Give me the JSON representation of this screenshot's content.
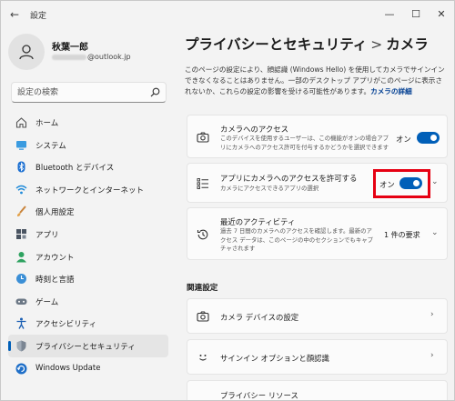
{
  "app": {
    "title": "設定",
    "back_icon": "back-arrow-icon"
  },
  "window_controls": {
    "minimize": "—",
    "maximize": "☐",
    "close": "✕"
  },
  "profile": {
    "name": "秋葉一郎",
    "email_visible": "@outlook.jp"
  },
  "search": {
    "placeholder": "設定の検索"
  },
  "nav": [
    {
      "label": "ホーム",
      "icon": "home-icon",
      "active": false
    },
    {
      "label": "システム",
      "icon": "system-icon",
      "active": false
    },
    {
      "label": "Bluetooth とデバイス",
      "icon": "bluetooth-icon",
      "active": false
    },
    {
      "label": "ネットワークとインターネット",
      "icon": "wifi-icon",
      "active": false
    },
    {
      "label": "個人用設定",
      "icon": "brush-icon",
      "active": false
    },
    {
      "label": "アプリ",
      "icon": "apps-icon",
      "active": false
    },
    {
      "label": "アカウント",
      "icon": "account-icon",
      "active": false
    },
    {
      "label": "時刻と言語",
      "icon": "time-language-icon",
      "active": false
    },
    {
      "label": "ゲーム",
      "icon": "gamepad-icon",
      "active": false
    },
    {
      "label": "アクセシビリティ",
      "icon": "accessibility-icon",
      "active": false
    },
    {
      "label": "プライバシーとセキュリティ",
      "icon": "shield-icon",
      "active": true
    },
    {
      "label": "Windows Update",
      "icon": "update-icon",
      "active": false
    }
  ],
  "header": {
    "breadcrumb_parent": "プライバシーとセキュリティ",
    "separator": ">",
    "title": "カメラ"
  },
  "intro": {
    "text": "このページの設定により、顔認識 (Windows Hello) を使用してカメラでサインインできなくなることはありません。一部のデスクトップ アプリがこのページに表示されないか、これらの設定の影響を受ける可能性があります。",
    "link": "カメラの詳細"
  },
  "cards": {
    "camera_access": {
      "title": "カメラへのアクセス",
      "subtitle": "このデバイスを使用するユーザーは、この機能がオンの場合アプリにカメラへのアクセス許可を付与するかどうかを選択できます",
      "toggle_label": "オン",
      "toggle_on": true
    },
    "app_access": {
      "title": "アプリにカメラへのアクセスを許可する",
      "subtitle": "カメラにアクセスできるアプリの選択",
      "toggle_label": "オン",
      "toggle_on": true
    },
    "recent_activity": {
      "title": "最近のアクティビティ",
      "subtitle": "過去 7 日間のカメラへのアクセスを確認します。最新のアクセス データは、このページの中のセクションでもキャプチャされます",
      "count": "1 件の要求"
    }
  },
  "related": {
    "heading": "関連設定",
    "items": [
      {
        "label": "カメラ デバイスの設定",
        "icon": "camera-icon"
      },
      {
        "label": "サインイン オプションと顔認識",
        "icon": "face-icon"
      },
      {
        "label": "プライバシー リソース",
        "icon": "privacy-icon"
      }
    ]
  },
  "colors": {
    "accent": "#005fb8",
    "highlight": "#e60012",
    "background": "#f3f3f3",
    "card": "#fbfbfb"
  }
}
